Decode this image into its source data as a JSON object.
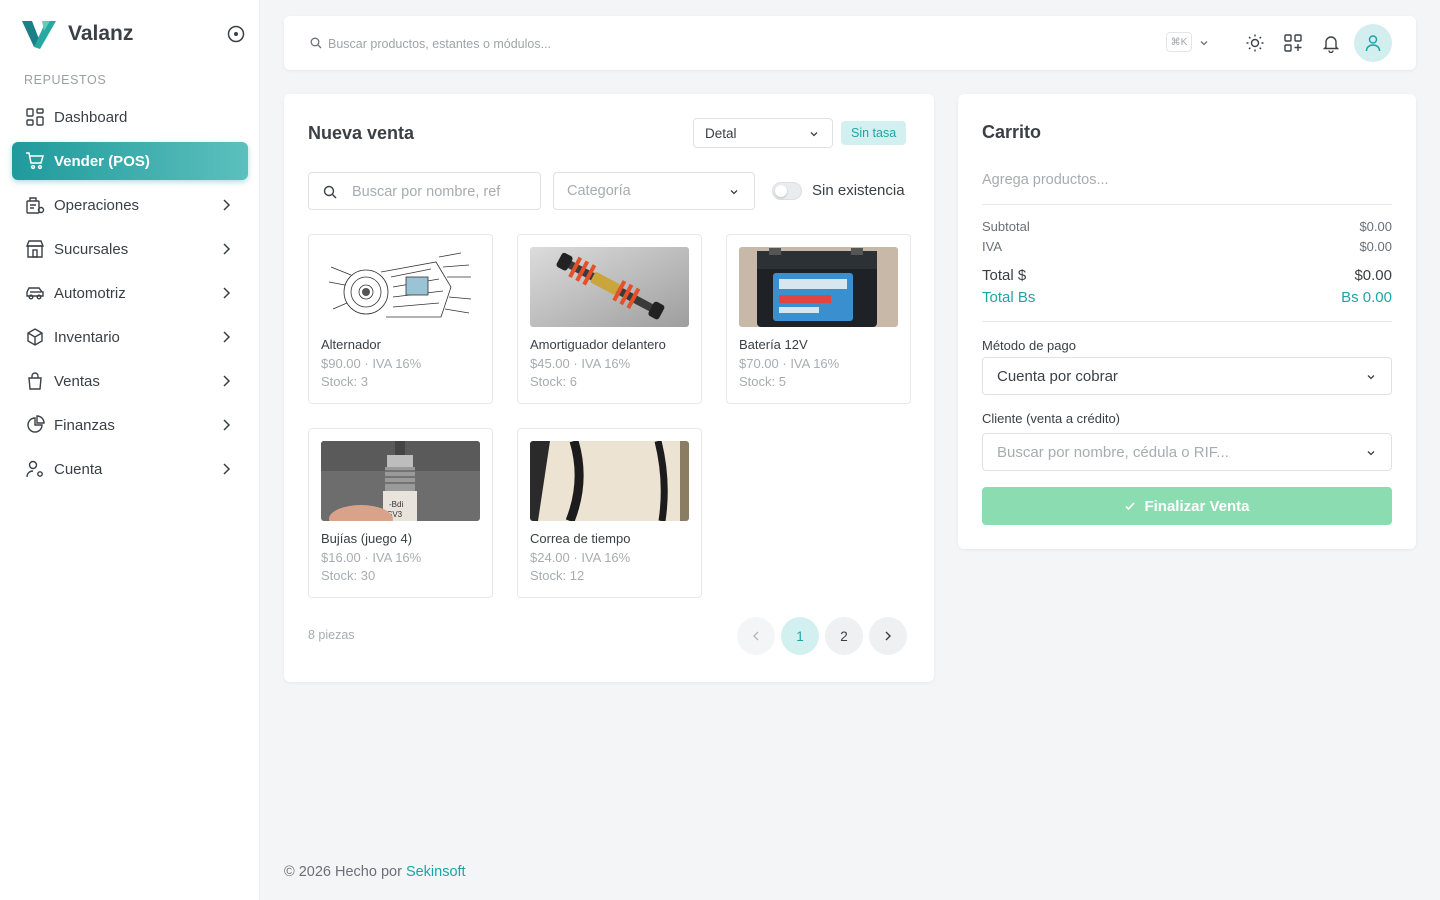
{
  "brand": {
    "name": "Valanz",
    "accent": "#1f9a9c"
  },
  "sidebar": {
    "section": "REPUESTOS",
    "items": [
      {
        "label": "Dashboard",
        "icon": "dashboard-icon",
        "active": false,
        "expandable": false
      },
      {
        "label": "Vender (POS)",
        "icon": "cart-icon",
        "active": true,
        "expandable": false
      },
      {
        "label": "Operaciones",
        "icon": "operations-icon",
        "active": false,
        "expandable": true
      },
      {
        "label": "Sucursales",
        "icon": "store-icon",
        "active": false,
        "expandable": true
      },
      {
        "label": "Automotriz",
        "icon": "car-icon",
        "active": false,
        "expandable": true
      },
      {
        "label": "Inventario",
        "icon": "box-icon",
        "active": false,
        "expandable": true
      },
      {
        "label": "Ventas",
        "icon": "shopping-bag-icon",
        "active": false,
        "expandable": true
      },
      {
        "label": "Finanzas",
        "icon": "pie-chart-icon",
        "active": false,
        "expandable": true
      },
      {
        "label": "Cuenta",
        "icon": "user-settings-icon",
        "active": false,
        "expandable": true
      }
    ]
  },
  "topbar": {
    "search_placeholder": "Buscar productos, estantes o módulos...",
    "shortcut": "⌘K"
  },
  "sale": {
    "title": "Nueva venta",
    "price_type": "Detal",
    "rate_badge": "Sin tasa",
    "search_placeholder": "Buscar por nombre, ref",
    "category_placeholder": "Categoría",
    "toggle_label": "Sin existencia",
    "products": [
      {
        "name": "Alternador",
        "price": "$90.00 · IVA 16%",
        "stock": "Stock: 3"
      },
      {
        "name": "Amortiguador delantero",
        "price": "$45.00 · IVA 16%",
        "stock": "Stock: 6"
      },
      {
        "name": "Batería 12V",
        "price": "$70.00 · IVA 16%",
        "stock": "Stock: 5"
      },
      {
        "name": "Bujías (juego 4)",
        "price": "$16.00 · IVA 16%",
        "stock": "Stock: 30"
      },
      {
        "name": "Correa de tiempo",
        "price": "$24.00 · IVA 16%",
        "stock": "Stock: 12"
      }
    ],
    "count_label": "8 piezas",
    "pagination": {
      "pages": [
        "1",
        "2"
      ],
      "current": "1"
    }
  },
  "cart": {
    "title": "Carrito",
    "empty_text": "Agrega productos...",
    "subtotal_label": "Subtotal",
    "subtotal_value": "$0.00",
    "iva_label": "IVA",
    "iva_value": "$0.00",
    "total_label": "Total $",
    "total_value": "$0.00",
    "total_bs_label": "Total Bs",
    "total_bs_value": "Bs 0.00",
    "payment_label": "Método de pago",
    "payment_value": "Cuenta por cobrar",
    "client_label": "Cliente (venta a crédito)",
    "client_placeholder": "Buscar por nombre, cédula o RIF...",
    "finish_label": "Finalizar Venta"
  },
  "footer": {
    "text": "© 2026 Hecho por",
    "link": "Sekinsoft"
  }
}
